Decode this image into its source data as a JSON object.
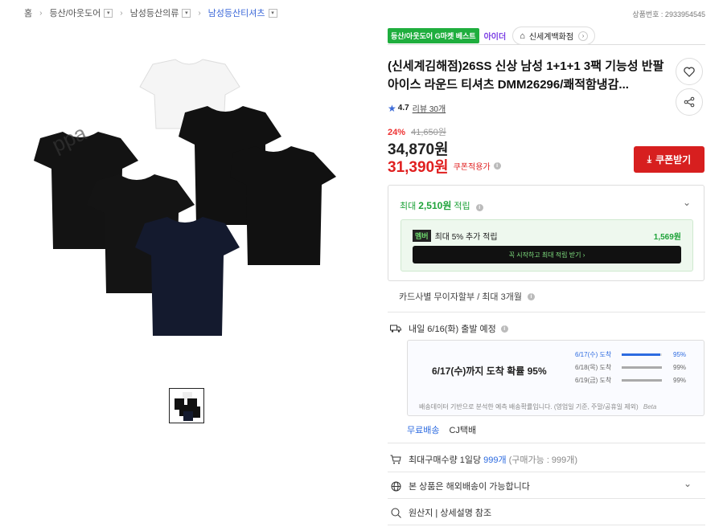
{
  "breadcrumb": {
    "home": "홈",
    "items": [
      "등산/아웃도어",
      "남성등산의류",
      "남성등산티셔츠"
    ]
  },
  "product_id_label": "상품번호 : 2933954545",
  "tags": {
    "category_badge": "등산/아웃도어 G마켓 베스트",
    "brand": "아이더",
    "store": "신세계백화점"
  },
  "title": "(신세계김해점)26SS 신상 남성 1+1+1 3팩 기능성 반팔 아이스 라운드 티셔츠 DMM26296/쾌적함냉감...",
  "rating": {
    "score": "4.7",
    "reviews": "리뷰 30개"
  },
  "price": {
    "discount_pct": "24%",
    "original": "41,650원",
    "sale": "34,870원",
    "coupon_price": "31,390원",
    "coupon_label": "쿠폰적용가"
  },
  "coupon_button": "쿠폰받기",
  "points": {
    "head_prefix": "최대 ",
    "head_amount": "2,510원",
    "head_suffix": " 적립",
    "member_badge": "멤버",
    "member_text": "최대 5% 추가 적립",
    "member_amount": "1,569원",
    "member_button": "꼭 시작하고 최대 적립 받기  ›"
  },
  "card_text": "카드사별 무이자할부 / 최대 3개월",
  "shipping": {
    "depart": "내일 6/16(화) 출발 예정",
    "headline": "6/17(수)까지 도착 확률 95%",
    "probs": [
      {
        "date": "6/17(수) 도착",
        "value": "95%",
        "fill": 0.95
      },
      {
        "date": "6/18(목) 도착",
        "value": "99%",
        "fill": 0.99
      },
      {
        "date": "6/19(금) 도착",
        "value": "99%",
        "fill": 0.99
      }
    ],
    "note": "배송데이터 기반으로 분석한 예측 배송확률입니다. (영업일 기준, 주말/공휴일 제외)",
    "beta": "Beta",
    "free": "무료배송",
    "carrier": "CJ택배"
  },
  "purchase_limit": {
    "prefix": "최대구매수량 1일당",
    "count": "999개",
    "sub": "(구매가능 : 999개)"
  },
  "international": "본 상품은 해외배송이 가능합니다",
  "origin": "원산지 | 상세설명 참조",
  "colors": {
    "accent_red": "#d71f1f",
    "accent_green": "#1fae3e",
    "accent_blue": "#2d6be0"
  }
}
